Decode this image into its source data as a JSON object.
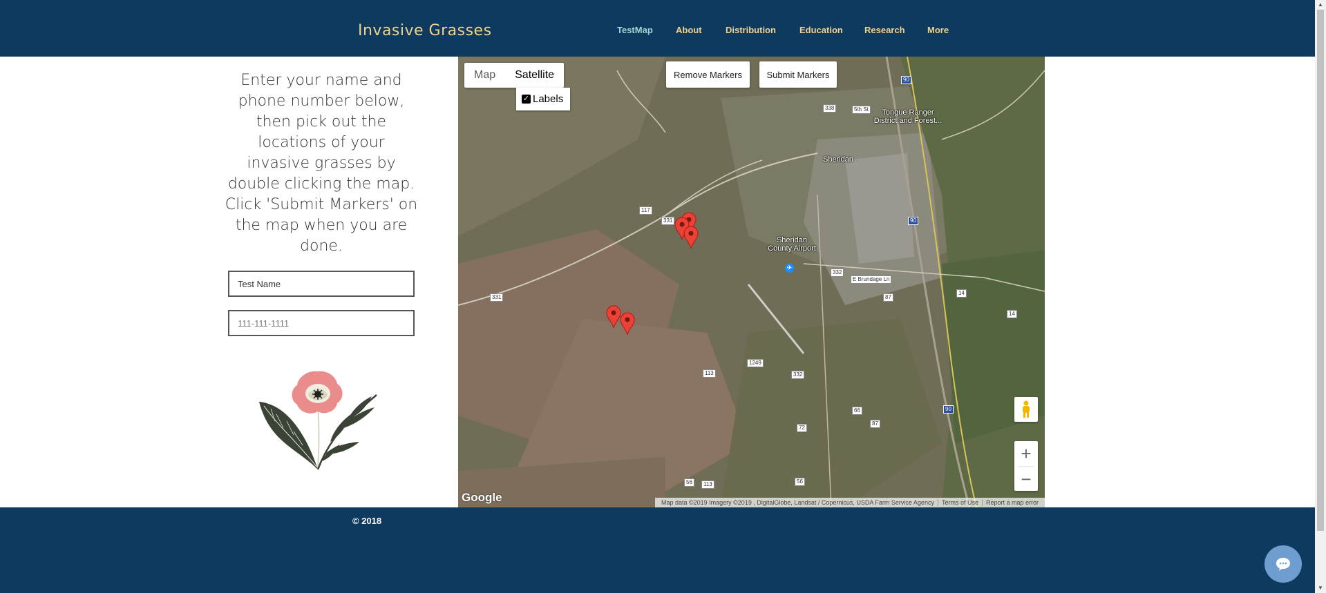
{
  "header": {
    "site_title": "Invasive Grasses",
    "nav": [
      {
        "label": "TestMap",
        "active": true
      },
      {
        "label": "About"
      },
      {
        "label": "Distribution"
      },
      {
        "label": "Education"
      },
      {
        "label": "Research"
      },
      {
        "label": "More"
      }
    ]
  },
  "instructions": {
    "text": "Enter your name and phone number below, then pick out the locations of your invasive grasses by double clicking the map. Click 'Submit Markers' on the map when you are done."
  },
  "form": {
    "name_value": "Test Name",
    "phone_placeholder": "111-111-1111"
  },
  "map": {
    "type_options": [
      "Map",
      "Satellite"
    ],
    "selected_type": "Satellite",
    "labels_checkbox": "Labels",
    "labels_checked": true,
    "remove_button": "Remove Markers",
    "submit_button": "Submit Markers",
    "zoom_in": "+",
    "zoom_out": "−",
    "logo": "Google",
    "attribution": "Map data ©2019 Imagery ©2019 , DigitalGlobe, Landsat / Copernicus, USDA Farm Service Agency",
    "terms": "Terms of Use",
    "report": "Report a map error",
    "places": {
      "sheridan": "Sheridan",
      "airport": "Sheridan County Airport",
      "ranger": "Tongue Ranger District and Forest..."
    },
    "road_labels": [
      "117",
      "331",
      "331",
      "332",
      "113",
      "1249",
      "332",
      "90",
      "90",
      "90",
      "14",
      "14",
      "87",
      "66",
      "87",
      "72",
      "56",
      "113",
      "56",
      "338",
      "5th St",
      "E Brundage Ln"
    ],
    "marker_count": 5
  },
  "footer": {
    "copyright": "© 2018"
  },
  "colors": {
    "header_bg": "#0f3a5f",
    "title_gold": "#f0d28c",
    "active_nav": "#9fd7d5",
    "marker_red": "#ea4335",
    "chat_bubble": "#6e9ecf"
  },
  "icons": [
    "flower-illustration",
    "pegman-icon",
    "map-marker-icon",
    "chat-icon",
    "checkbox-icon",
    "airport-icon"
  ]
}
